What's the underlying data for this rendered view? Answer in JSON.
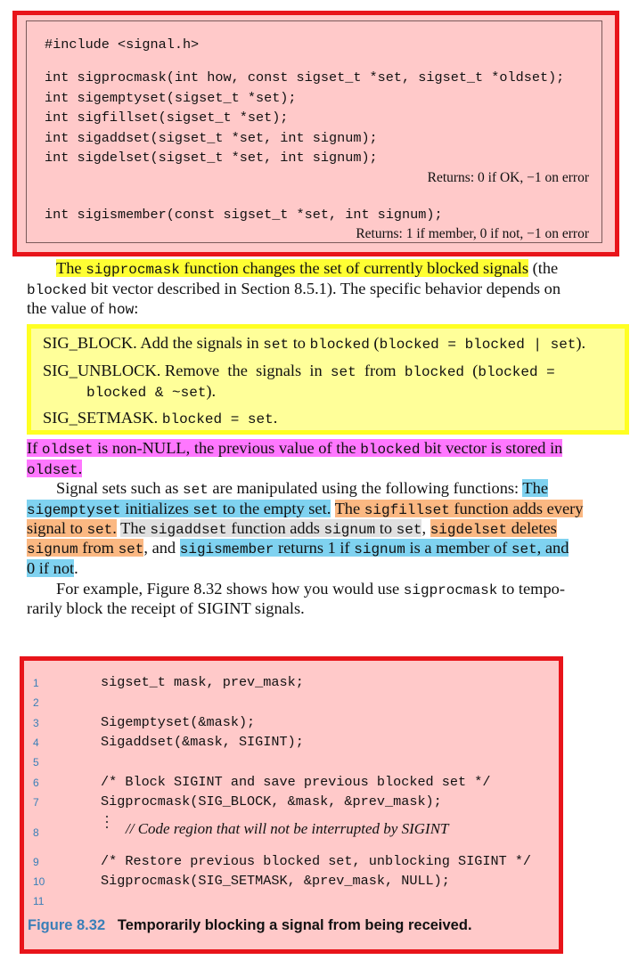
{
  "prototypes": {
    "include": "#include <signal.h>",
    "lines": [
      "int sigprocmask(int how, const sigset_t *set, sigset_t *oldset);",
      "int sigemptyset(sigset_t *set);",
      "int sigfillset(sigset_t *set);",
      "int sigaddset(sigset_t *set, int signum);",
      "int sigdelset(sigset_t *set, int signum);"
    ],
    "returns1": "Returns: 0 if OK, −1 on error",
    "ismember": "int sigismember(const sigset_t *set, int signum);",
    "returns2": "Returns: 1 if member, 0 if not, −1 on error"
  },
  "para1": {
    "l1_hl_a": "The ",
    "l1_hl_code": "sigprocmask",
    "l1_hl_b": " function changes the set of currently blocked signals",
    "l1_rest": " (the",
    "l2_code": "blocked",
    "l2_rest": " bit vector described in Section 8.5.1). The specific behavior depends on",
    "l3_a": "the value of ",
    "l3_code": "how",
    "l3_b": ":"
  },
  "options": {
    "block": {
      "name": "SIG_BLOCK.",
      "t1": " Add the signals in ",
      "c1": "set",
      "t2": " to ",
      "c2": "blocked",
      "t3": " (",
      "c3": "blocked = blocked | set",
      "t4": ")."
    },
    "unblock": {
      "name": "SIG_UNBLOCK.",
      "t1": " Remove  the  signals  in  ",
      "c1": "set",
      "t2": "  from  ",
      "c2": "blocked",
      "t3": "  (",
      "c3": "blocked =",
      "c4": "blocked & ~set",
      "t4": ")."
    },
    "setmask": {
      "name": "SIG_SETMASK.",
      "c1": "blocked = set",
      "t1": "."
    }
  },
  "para2": {
    "l1_a": "If ",
    "l1_code1": "oldset",
    "l1_b": " is non-NULL, the previous value of the ",
    "l1_code2": "blocked",
    "l1_c": " bit vector is stored in",
    "l2_code": "oldset",
    "l2_b": "."
  },
  "para3": {
    "l1_a": "Signal sets such as ",
    "l1_code": "set",
    "l1_b": " are manipulated using the following functions: ",
    "l1_hl": "The",
    "l2_code1": "sigemptyset",
    "l2_a": " initializes ",
    "l2_code2": "set",
    "l2_b": " to the empty set.",
    "l2_sp": " ",
    "l2_o1": "The ",
    "l2_code3": "sigfillset",
    "l2_o2": " function adds every",
    "l3_o1": "signal to ",
    "l3_code1": "set",
    "l3_o2": ".",
    "l3_sp": " ",
    "l3_g1": "The ",
    "l3_code2": "sigaddset",
    "l3_g2": " function adds ",
    "l3_code3": "signum",
    "l3_g3": " to ",
    "l3_code4": "set",
    "l3_comma": ", ",
    "l3_code5": "sigdelset",
    "l3_o3": " deletes",
    "l4_code1": "signum",
    "l4_o1": " from ",
    "l4_code2": "set",
    "l4_comma": ", and ",
    "l4_code3": "sigismember",
    "l4_b1": " returns 1 if ",
    "l4_code4": "signum",
    "l4_b2": " is a member of ",
    "l4_code5": "set",
    "l4_b3": ", and",
    "l5": "0 if not",
    "l5_dot": "."
  },
  "para4": {
    "l1_a": "For example, Figure 8.32 shows how you would use ",
    "l1_code": "sigprocmask",
    "l1_b": " to tempo-",
    "l2": "rarily block the receipt of SIGINT signals."
  },
  "figure": {
    "lines": [
      {
        "n": "1",
        "code": "sigset_t mask, prev_mask;"
      },
      {
        "n": "2",
        "code": ""
      },
      {
        "n": "3",
        "code": "Sigemptyset(&mask);"
      },
      {
        "n": "4",
        "code": "Sigaddset(&mask, SIGINT);"
      },
      {
        "n": "5",
        "code": ""
      },
      {
        "n": "6",
        "code": "/* Block SIGINT and save previous blocked set */"
      },
      {
        "n": "7",
        "code": "Sigprocmask(SIG_BLOCK, &mask, &prev_mask);"
      },
      {
        "n": "8",
        "code": "// Code region that will not be interrupted by SIGINT"
      },
      {
        "n": "9",
        "code": "/* Restore previous blocked set, unblocking SIGINT */"
      },
      {
        "n": "10",
        "code": "Sigprocmask(SIG_SETMASK, &prev_mask, NULL);"
      },
      {
        "n": "11",
        "code": ""
      }
    ],
    "caption_num": "Figure 8.32",
    "caption_text": "Temporarily blocking a signal from being received."
  },
  "colors": {
    "red_border": "#e8141a",
    "pink_fill": "#ffc9c9",
    "yellow_highlight": "#ffff33",
    "magenta_highlight": "#ff77ff",
    "blue_highlight": "#7fd2f0",
    "orange_highlight": "#fbb882",
    "gray_highlight": "#e0e0e0",
    "figure_blue": "#3a7fb8"
  }
}
